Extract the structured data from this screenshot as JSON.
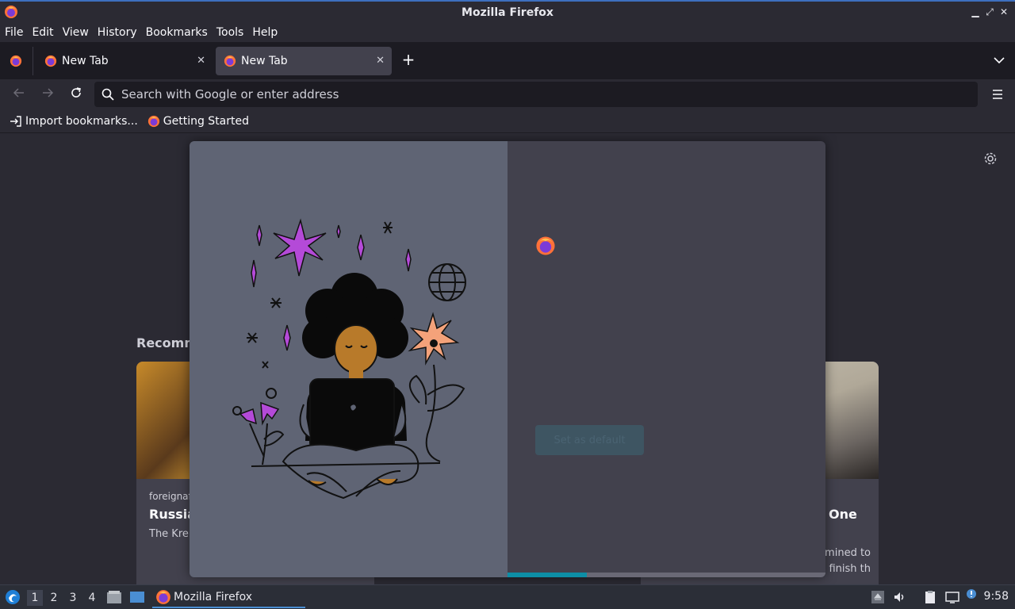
{
  "window": {
    "title": "Mozilla Firefox",
    "controls": [
      "minimize",
      "maximize",
      "close"
    ]
  },
  "menubar": {
    "items": [
      "File",
      "Edit",
      "View",
      "History",
      "Bookmarks",
      "Tools",
      "Help"
    ]
  },
  "tabs": [
    {
      "label": "New Tab",
      "selected": false
    },
    {
      "label": "New Tab",
      "selected": true
    }
  ],
  "navbar": {
    "search_placeholder": "Search with Google or enter address"
  },
  "bookmarks": {
    "items": [
      {
        "label": "Import bookmarks...",
        "icon": "import-icon"
      },
      {
        "label": "Getting Started",
        "icon": "firefox-icon"
      }
    ]
  },
  "content": {
    "recommended_heading": "Recomm",
    "cards": [
      {
        "source": "foreignaf",
        "headline": "Russia",
        "excerpt": "The Krer fight."
      },
      {
        "source": "",
        "headline": "One",
        "excerpt": "during Applegate was determined to finish th"
      }
    ]
  },
  "modal": {
    "primary_button": "Set as default",
    "progress": 0.25,
    "colors": {
      "left_panel": "#5f6474",
      "right_panel": "#42414d",
      "progress": "#0d8ea6"
    }
  },
  "taskbar": {
    "workspaces": [
      "1",
      "2",
      "3",
      "4"
    ],
    "active_workspace": "1",
    "task_label": "Mozilla Firefox",
    "clock": "9:58"
  }
}
